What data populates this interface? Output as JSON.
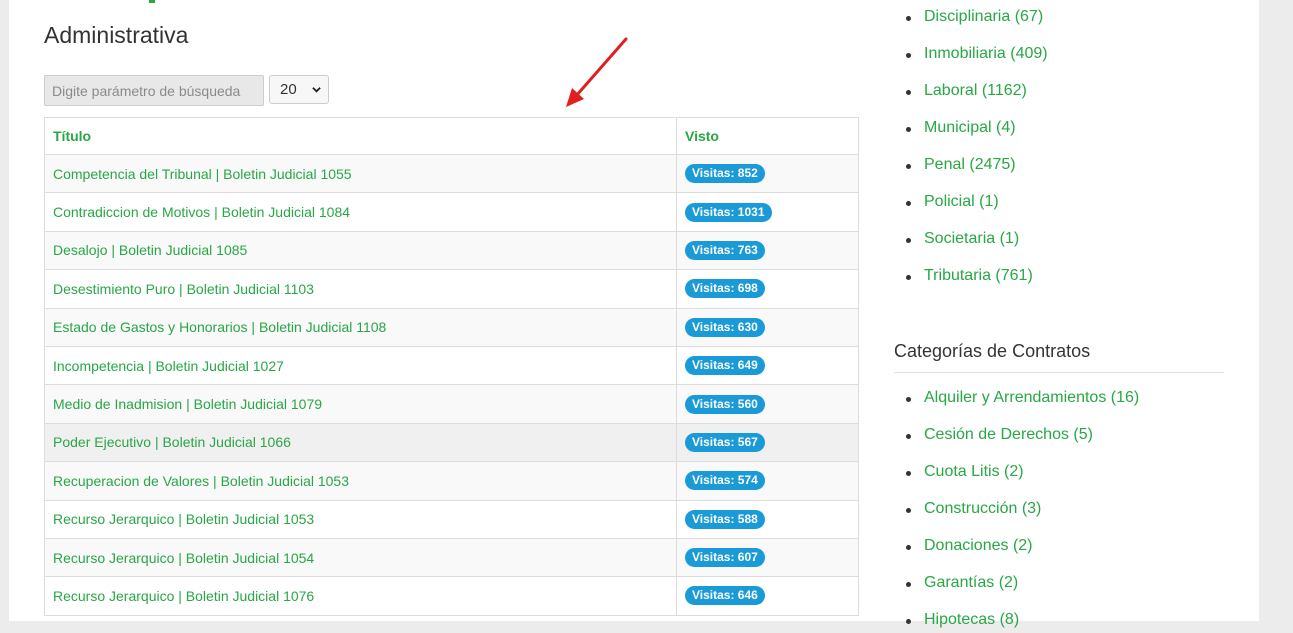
{
  "main": {
    "title": "Administrativa",
    "search": {
      "placeholder": "Digite parámetro de búsqueda",
      "value": ""
    },
    "page_size": {
      "selected": "20"
    },
    "table": {
      "headers": [
        "Título",
        "Visto"
      ],
      "rows": [
        {
          "title": "Competencia del Tribunal | Boletin Judicial 1055",
          "views": "Visitas: 852"
        },
        {
          "title": "Contradiccion de Motivos | Boletin Judicial 1084",
          "views": "Visitas: 1031"
        },
        {
          "title": "Desalojo | Boletin Judicial 1085",
          "views": "Visitas: 763"
        },
        {
          "title": "Desestimiento Puro | Boletin Judicial 1103",
          "views": "Visitas: 698"
        },
        {
          "title": "Estado de Gastos y Honorarios | Boletin Judicial 1108",
          "views": "Visitas: 630"
        },
        {
          "title": "Incompetencia | Boletin Judicial 1027",
          "views": "Visitas: 649"
        },
        {
          "title": "Medio de Inadmision | Boletin Judicial 1079",
          "views": "Visitas: 560"
        },
        {
          "title": "Poder Ejecutivo | Boletin Judicial 1066",
          "views": "Visitas: 567"
        },
        {
          "title": "Recuperacion de Valores | Boletin Judicial 1053",
          "views": "Visitas: 574"
        },
        {
          "title": "Recurso Jerarquico | Boletin Judicial 1053",
          "views": "Visitas: 588"
        },
        {
          "title": "Recurso Jerarquico | Boletin Judicial 1054",
          "views": "Visitas: 607"
        },
        {
          "title": "Recurso Jerarquico | Boletin Judicial 1076",
          "views": "Visitas: 646"
        }
      ]
    }
  },
  "sidebar": {
    "law_categories": [
      "Disciplinaria (67)",
      "Inmobiliaria (409)",
      "Laboral (1162)",
      "Municipal (4)",
      "Penal (2475)",
      "Policial (1)",
      "Societaria (1)",
      "Tributaria (761)"
    ],
    "contracts_title": "Categorías de Contratos",
    "contract_categories": [
      "Alquiler y Arrendamientos (16)",
      "Cesión de Derechos (5)",
      "Cuota Litis (2)",
      "Construcción (3)",
      "Donaciones (2)",
      "Garantías (2)",
      "Hipotecas (8)"
    ]
  },
  "colors": {
    "accent_green": "#28a745",
    "badge_blue": "#1a9bd7",
    "annotation_arrow": "#e02020"
  }
}
